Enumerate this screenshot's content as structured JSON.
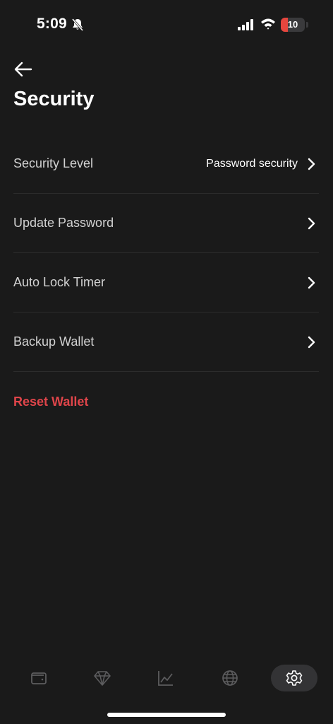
{
  "status_bar": {
    "time": "5:09",
    "battery_level": "10",
    "battery_fraction": 0.1
  },
  "header": {
    "title": "Security"
  },
  "settings": {
    "items": [
      {
        "label": "Security Level",
        "value": "Password security"
      },
      {
        "label": "Update Password"
      },
      {
        "label": "Auto Lock Timer"
      },
      {
        "label": "Backup Wallet"
      }
    ],
    "reset_label": "Reset Wallet"
  },
  "bottom_nav": {
    "items": [
      {
        "icon": "wallet-icon"
      },
      {
        "icon": "diamond-icon"
      },
      {
        "icon": "chart-icon"
      },
      {
        "icon": "globe-icon"
      },
      {
        "icon": "gear-icon",
        "active": true
      }
    ]
  },
  "colors": {
    "background": "#1a1a1a",
    "danger": "#e0454a",
    "muted_text": "#d2d2d2",
    "battery_low": "#e5463e"
  }
}
